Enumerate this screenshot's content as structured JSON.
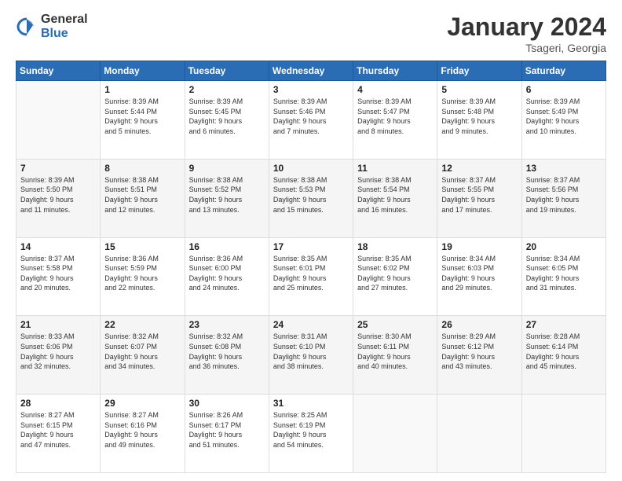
{
  "logo": {
    "general": "General",
    "blue": "Blue"
  },
  "title": {
    "month": "January 2024",
    "location": "Tsageri, Georgia"
  },
  "weekdays": [
    "Sunday",
    "Monday",
    "Tuesday",
    "Wednesday",
    "Thursday",
    "Friday",
    "Saturday"
  ],
  "weeks": [
    [
      {
        "num": "",
        "info": ""
      },
      {
        "num": "1",
        "info": "Sunrise: 8:39 AM\nSunset: 5:44 PM\nDaylight: 9 hours\nand 5 minutes."
      },
      {
        "num": "2",
        "info": "Sunrise: 8:39 AM\nSunset: 5:45 PM\nDaylight: 9 hours\nand 6 minutes."
      },
      {
        "num": "3",
        "info": "Sunrise: 8:39 AM\nSunset: 5:46 PM\nDaylight: 9 hours\nand 7 minutes."
      },
      {
        "num": "4",
        "info": "Sunrise: 8:39 AM\nSunset: 5:47 PM\nDaylight: 9 hours\nand 8 minutes."
      },
      {
        "num": "5",
        "info": "Sunrise: 8:39 AM\nSunset: 5:48 PM\nDaylight: 9 hours\nand 9 minutes."
      },
      {
        "num": "6",
        "info": "Sunrise: 8:39 AM\nSunset: 5:49 PM\nDaylight: 9 hours\nand 10 minutes."
      }
    ],
    [
      {
        "num": "7",
        "info": "Sunrise: 8:39 AM\nSunset: 5:50 PM\nDaylight: 9 hours\nand 11 minutes."
      },
      {
        "num": "8",
        "info": "Sunrise: 8:38 AM\nSunset: 5:51 PM\nDaylight: 9 hours\nand 12 minutes."
      },
      {
        "num": "9",
        "info": "Sunrise: 8:38 AM\nSunset: 5:52 PM\nDaylight: 9 hours\nand 13 minutes."
      },
      {
        "num": "10",
        "info": "Sunrise: 8:38 AM\nSunset: 5:53 PM\nDaylight: 9 hours\nand 15 minutes."
      },
      {
        "num": "11",
        "info": "Sunrise: 8:38 AM\nSunset: 5:54 PM\nDaylight: 9 hours\nand 16 minutes."
      },
      {
        "num": "12",
        "info": "Sunrise: 8:37 AM\nSunset: 5:55 PM\nDaylight: 9 hours\nand 17 minutes."
      },
      {
        "num": "13",
        "info": "Sunrise: 8:37 AM\nSunset: 5:56 PM\nDaylight: 9 hours\nand 19 minutes."
      }
    ],
    [
      {
        "num": "14",
        "info": "Sunrise: 8:37 AM\nSunset: 5:58 PM\nDaylight: 9 hours\nand 20 minutes."
      },
      {
        "num": "15",
        "info": "Sunrise: 8:36 AM\nSunset: 5:59 PM\nDaylight: 9 hours\nand 22 minutes."
      },
      {
        "num": "16",
        "info": "Sunrise: 8:36 AM\nSunset: 6:00 PM\nDaylight: 9 hours\nand 24 minutes."
      },
      {
        "num": "17",
        "info": "Sunrise: 8:35 AM\nSunset: 6:01 PM\nDaylight: 9 hours\nand 25 minutes."
      },
      {
        "num": "18",
        "info": "Sunrise: 8:35 AM\nSunset: 6:02 PM\nDaylight: 9 hours\nand 27 minutes."
      },
      {
        "num": "19",
        "info": "Sunrise: 8:34 AM\nSunset: 6:03 PM\nDaylight: 9 hours\nand 29 minutes."
      },
      {
        "num": "20",
        "info": "Sunrise: 8:34 AM\nSunset: 6:05 PM\nDaylight: 9 hours\nand 31 minutes."
      }
    ],
    [
      {
        "num": "21",
        "info": "Sunrise: 8:33 AM\nSunset: 6:06 PM\nDaylight: 9 hours\nand 32 minutes."
      },
      {
        "num": "22",
        "info": "Sunrise: 8:32 AM\nSunset: 6:07 PM\nDaylight: 9 hours\nand 34 minutes."
      },
      {
        "num": "23",
        "info": "Sunrise: 8:32 AM\nSunset: 6:08 PM\nDaylight: 9 hours\nand 36 minutes."
      },
      {
        "num": "24",
        "info": "Sunrise: 8:31 AM\nSunset: 6:10 PM\nDaylight: 9 hours\nand 38 minutes."
      },
      {
        "num": "25",
        "info": "Sunrise: 8:30 AM\nSunset: 6:11 PM\nDaylight: 9 hours\nand 40 minutes."
      },
      {
        "num": "26",
        "info": "Sunrise: 8:29 AM\nSunset: 6:12 PM\nDaylight: 9 hours\nand 43 minutes."
      },
      {
        "num": "27",
        "info": "Sunrise: 8:28 AM\nSunset: 6:14 PM\nDaylight: 9 hours\nand 45 minutes."
      }
    ],
    [
      {
        "num": "28",
        "info": "Sunrise: 8:27 AM\nSunset: 6:15 PM\nDaylight: 9 hours\nand 47 minutes."
      },
      {
        "num": "29",
        "info": "Sunrise: 8:27 AM\nSunset: 6:16 PM\nDaylight: 9 hours\nand 49 minutes."
      },
      {
        "num": "30",
        "info": "Sunrise: 8:26 AM\nSunset: 6:17 PM\nDaylight: 9 hours\nand 51 minutes."
      },
      {
        "num": "31",
        "info": "Sunrise: 8:25 AM\nSunset: 6:19 PM\nDaylight: 9 hours\nand 54 minutes."
      },
      {
        "num": "",
        "info": ""
      },
      {
        "num": "",
        "info": ""
      },
      {
        "num": "",
        "info": ""
      }
    ]
  ]
}
